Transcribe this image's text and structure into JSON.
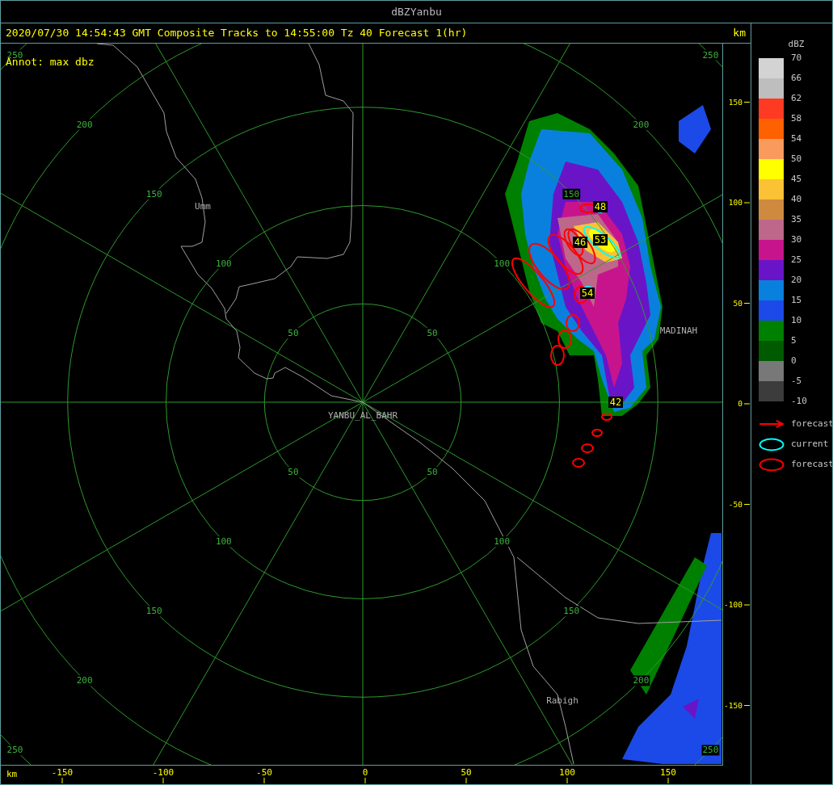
{
  "window": {
    "title": "dBZYanbu"
  },
  "header": {
    "text": "2020/07/30 14:54:43 GMT Composite Tracks to 14:55:00 Tz 40 Forecast 1(hr)",
    "unit": "km"
  },
  "annotation": "Annot: max dbz",
  "map": {
    "ring_labels": [
      "50",
      "100",
      "150",
      "200",
      "250",
      "50",
      "100",
      "150",
      "200",
      "250",
      "50",
      "100",
      "150",
      "200",
      "250",
      "50",
      "100",
      "150",
      "200",
      "250"
    ],
    "places": [
      "Umm",
      "YANBU_AL_BAHR",
      "MADINAH",
      "Rabigh"
    ],
    "storm_labels": [
      "48",
      "46",
      "53",
      "54",
      "42"
    ]
  },
  "y_axis": {
    "ticks": [
      "150",
      "100",
      "50",
      "0",
      "-50",
      "-100",
      "-150"
    ]
  },
  "x_axis": {
    "unit": "km",
    "ticks": [
      "-150",
      "-100",
      "-50",
      "0",
      "50",
      "100",
      "150"
    ]
  },
  "legend": {
    "title": "dBZ",
    "bins": [
      {
        "label": "70",
        "color": "#d3d3d3"
      },
      {
        "label": "66",
        "color": "#bebebe"
      },
      {
        "label": "62",
        "color": "#ff3a22"
      },
      {
        "label": "58",
        "color": "#ff6000"
      },
      {
        "label": "54",
        "color": "#fa9a5c"
      },
      {
        "label": "50",
        "color": "#ffff00"
      },
      {
        "label": "45",
        "color": "#fcc235"
      },
      {
        "label": "40",
        "color": "#cf8a40"
      },
      {
        "label": "35",
        "color": "#bd678a"
      },
      {
        "label": "30",
        "color": "#c8148c"
      },
      {
        "label": "25",
        "color": "#6a14c8"
      },
      {
        "label": "20",
        "color": "#0a80de"
      },
      {
        "label": "15",
        "color": "#1c4ae8"
      },
      {
        "label": "10",
        "color": "#008000"
      },
      {
        "label": "5",
        "color": "#005a00"
      },
      {
        "label": "0",
        "color": "#787878"
      },
      {
        "label": "-5",
        "color": "#3c3c3c"
      }
    ],
    "bottom_label": "-10",
    "items": [
      {
        "kind": "arrow",
        "color": "#ff0000",
        "label": "forecast"
      },
      {
        "kind": "ellipse",
        "color": "#00ffff",
        "label": "current"
      },
      {
        "kind": "ellipse",
        "color": "#ff0000",
        "label": "forecast"
      }
    ]
  }
}
